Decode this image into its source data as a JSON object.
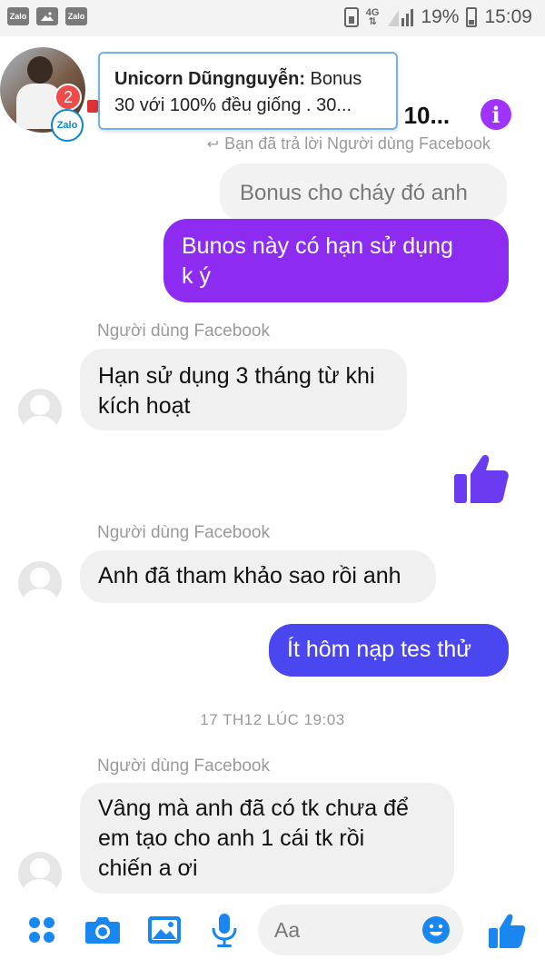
{
  "status_bar": {
    "network": "4G",
    "battery": "19%",
    "time": "15:09",
    "left_icons": [
      "Zalo",
      "image",
      "Zalo"
    ]
  },
  "header": {
    "avatar_badge": "2",
    "zalo_badge": "Zalo",
    "title_visible": "S 10...",
    "info_icon": "info-icon"
  },
  "notification": {
    "sender": "Unicorn Dũngnguyễn:",
    "line1_rest": " Bonus",
    "line2": "30 với 100% đều giống . 30..."
  },
  "messages": {
    "reply_note": "Bạn đã trả lời Người dùng Facebook",
    "quoted": "Bonus cho cháy đó anh",
    "purple_msg_l1": "Bunos  này  có hạn  sử dụng",
    "purple_msg_l2": "k ý",
    "sender1": "Người dùng Facebook",
    "in1_l1": "Hạn sử dụng 3 tháng từ khi",
    "in1_l2": "kích hoạt",
    "sender2": "Người dùng Facebook",
    "in2": "Anh đã tham khảo sao rồi anh",
    "blue_msg": "Ít hôm nạp tes  thử",
    "timestamp": "17 TH12 LÚC 19:03",
    "sender3": "Người dùng Facebook",
    "in3_l1": "Vâng mà anh đã có tk chưa để",
    "in3_l2": "em tạo cho anh 1 cái tk rồi",
    "in3_l3": "chiến a ơi"
  },
  "composer": {
    "placeholder": "Aa"
  },
  "colors": {
    "purple": "#8d2cf0",
    "blue": "#4a46f0",
    "icon_blue": "#1a87f0",
    "info": "#a033ff"
  }
}
